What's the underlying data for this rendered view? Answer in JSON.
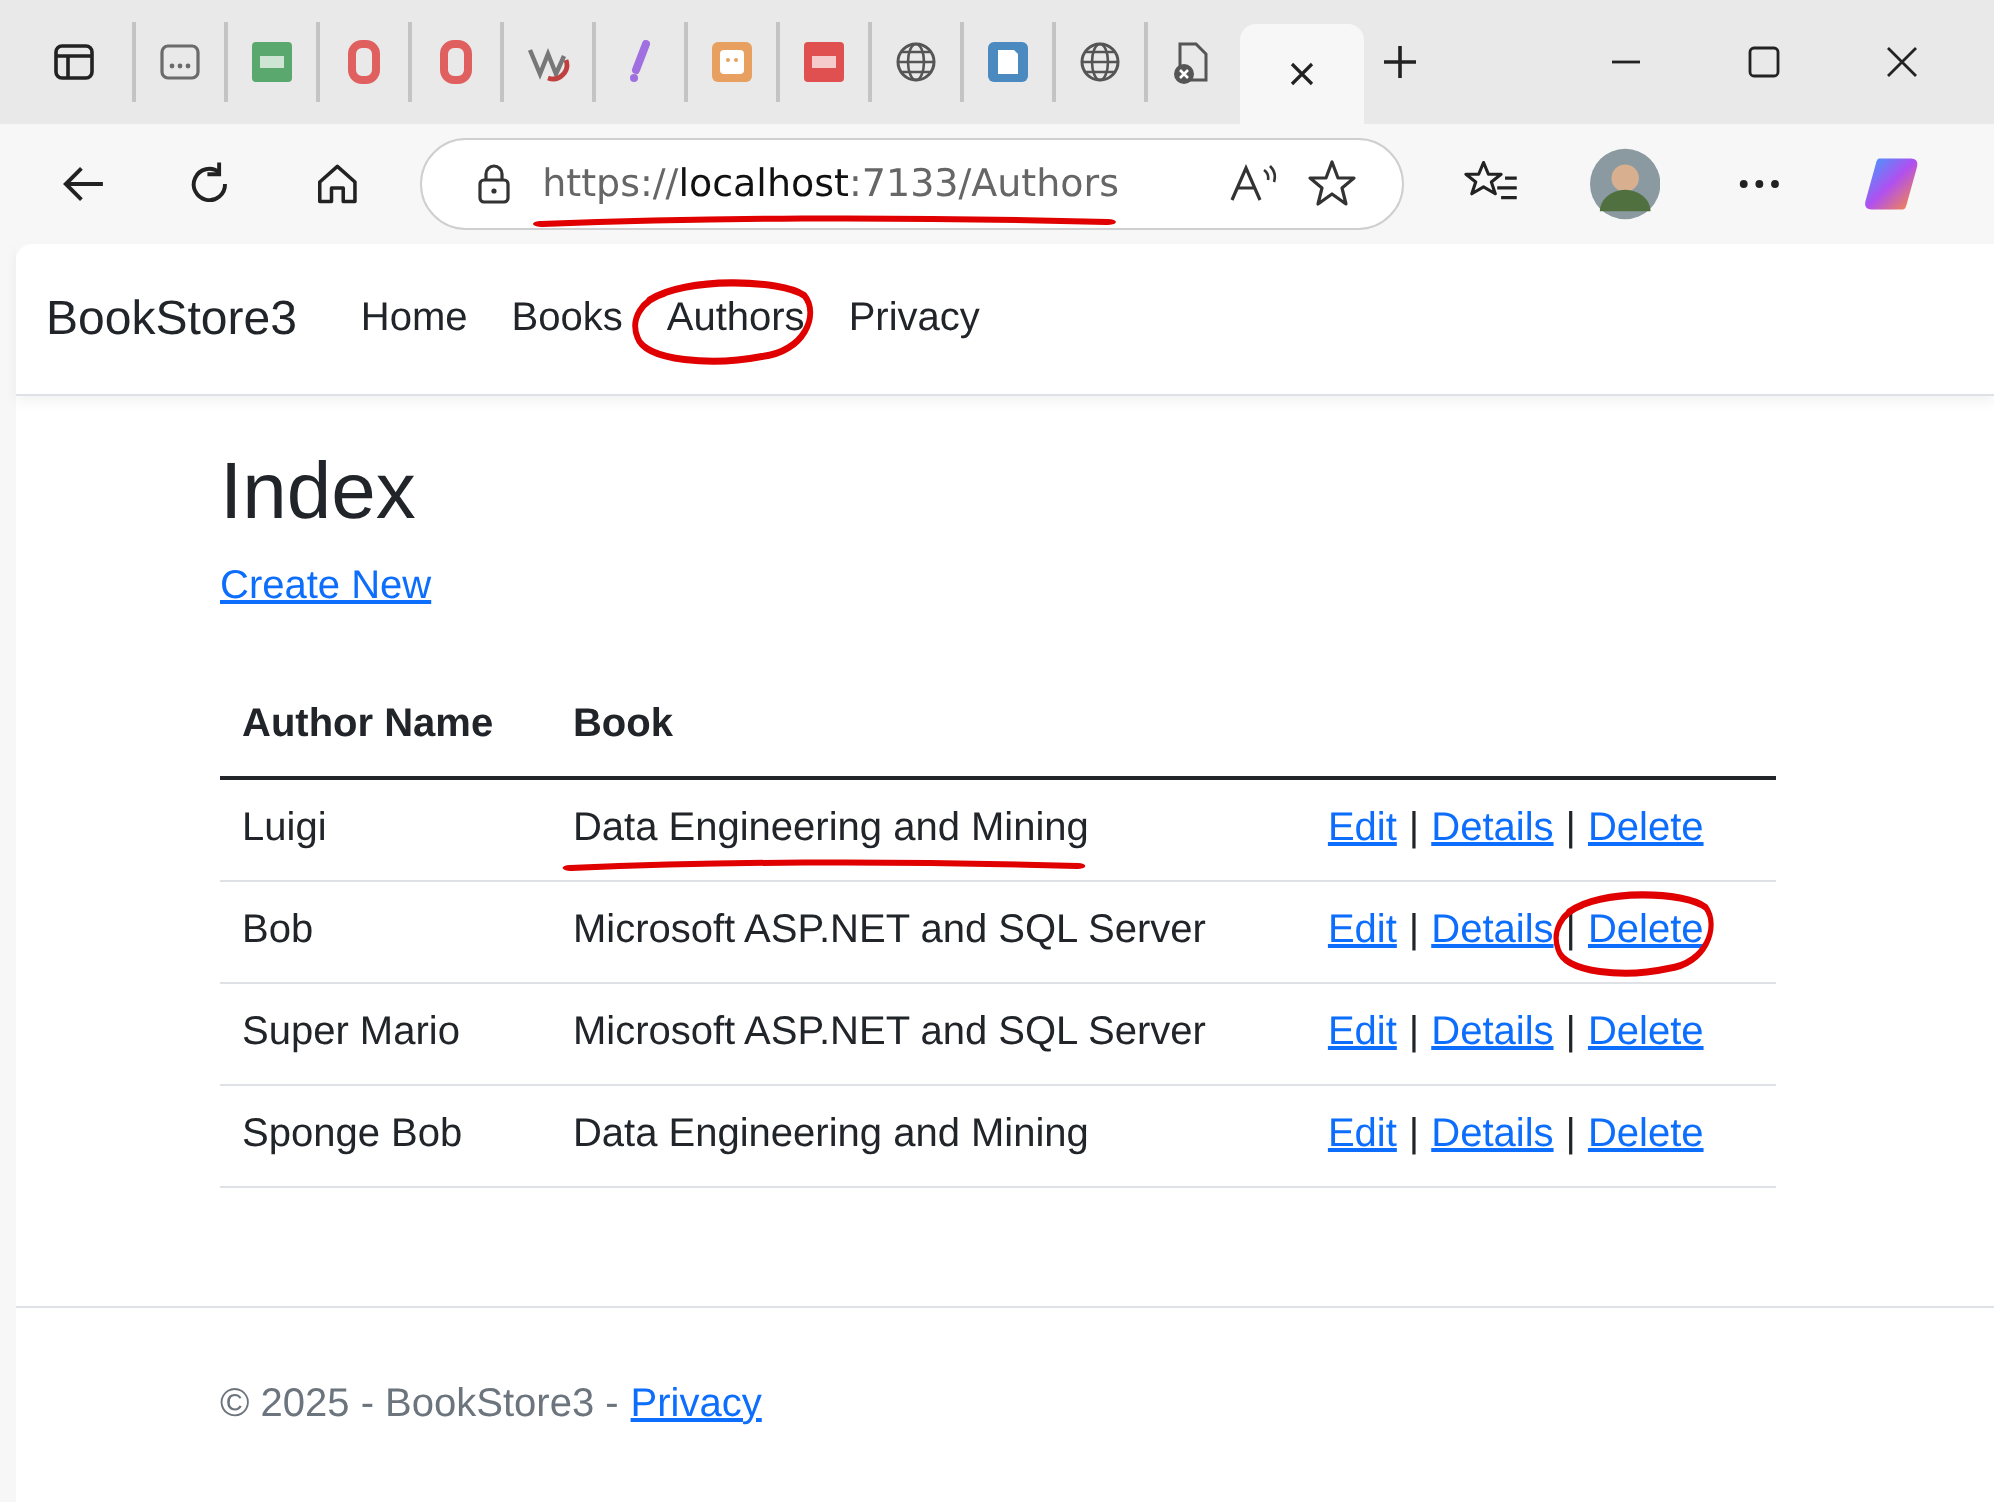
{
  "browser": {
    "tabs": [
      {
        "kind": "app",
        "selected": false
      },
      {
        "kind": "green",
        "selected": false
      },
      {
        "kind": "ring",
        "selected": false
      },
      {
        "kind": "ring",
        "selected": false
      },
      {
        "kind": "swirl",
        "selected": false
      },
      {
        "kind": "bang",
        "selected": false
      },
      {
        "kind": "face",
        "selected": false
      },
      {
        "kind": "red",
        "selected": false
      },
      {
        "kind": "globe",
        "selected": false
      },
      {
        "kind": "note",
        "selected": false
      },
      {
        "kind": "globe",
        "selected": false
      },
      {
        "kind": "doc",
        "selected": false
      },
      {
        "kind": "close",
        "selected": true
      }
    ],
    "address": {
      "scheme": "https://",
      "host": "localhost",
      "rest": ":7133/Authors",
      "underlined": true
    }
  },
  "site": {
    "brand": "BookStore3",
    "nav": [
      {
        "label": "Home",
        "circled": false
      },
      {
        "label": "Books",
        "circled": false
      },
      {
        "label": "Authors",
        "circled": true
      },
      {
        "label": "Privacy",
        "circled": false
      }
    ],
    "heading": "Index",
    "create_link": "Create New",
    "table": {
      "columns": [
        "Author Name",
        "Book"
      ],
      "rows": [
        {
          "author": "Luigi",
          "book": "Data Engineering and Mining",
          "book_underlined": true,
          "actions": [
            {
              "kind": "link",
              "label": "Edit",
              "circled": false
            },
            {
              "kind": "separator",
              "label": "|"
            },
            {
              "kind": "link",
              "label": "Details",
              "circled": false
            },
            {
              "kind": "separator",
              "label": "|"
            },
            {
              "kind": "link",
              "label": "Delete",
              "circled": false
            }
          ]
        },
        {
          "author": "Bob",
          "book": "Microsoft ASP.NET and SQL Server",
          "book_underlined": false,
          "actions": [
            {
              "kind": "link",
              "label": "Edit",
              "circled": false
            },
            {
              "kind": "separator",
              "label": "|"
            },
            {
              "kind": "link",
              "label": "Details",
              "circled": false
            },
            {
              "kind": "separator",
              "label": "|"
            },
            {
              "kind": "link",
              "label": "Delete",
              "circled": true
            }
          ]
        },
        {
          "author": "Super Mario",
          "book": "Microsoft ASP.NET and SQL Server",
          "book_underlined": false,
          "actions": [
            {
              "kind": "link",
              "label": "Edit",
              "circled": false
            },
            {
              "kind": "separator",
              "label": "|"
            },
            {
              "kind": "link",
              "label": "Details",
              "circled": false
            },
            {
              "kind": "separator",
              "label": "|"
            },
            {
              "kind": "link",
              "label": "Delete",
              "circled": false
            }
          ]
        },
        {
          "author": "Sponge Bob",
          "book": "Data Engineering and Mining",
          "book_underlined": false,
          "actions": [
            {
              "kind": "link",
              "label": "Edit",
              "circled": false
            },
            {
              "kind": "separator",
              "label": "|"
            },
            {
              "kind": "link",
              "label": "Details",
              "circled": false
            },
            {
              "kind": "separator",
              "label": "|"
            },
            {
              "kind": "link",
              "label": "Delete",
              "circled": false
            }
          ]
        }
      ]
    },
    "footer": {
      "text": "© 2025 - BookStore3 -",
      "link": "Privacy"
    }
  }
}
